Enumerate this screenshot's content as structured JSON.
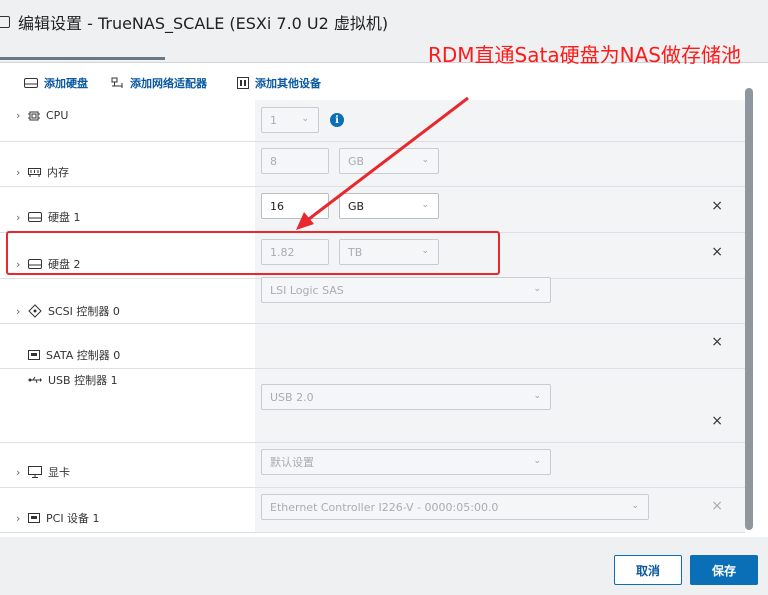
{
  "window": {
    "title": "编辑设置 - TrueNAS_SCALE (ESXi 7.0 U2 虚拟机)"
  },
  "toolbar": {
    "add_disk": "添加硬盘",
    "add_nic": "添加网络适配器",
    "add_other": "添加其他设备"
  },
  "rows": {
    "cpu": {
      "label": "CPU",
      "value": "1"
    },
    "memory": {
      "label": "内存",
      "value": "8",
      "unit": "GB"
    },
    "disk1": {
      "label": "硬盘 1",
      "value": "16",
      "unit": "GB"
    },
    "disk2": {
      "label": "硬盘 2",
      "value": "1.82",
      "unit": "TB"
    },
    "scsi": {
      "label": "SCSI 控制器 0",
      "value": "LSI Logic SAS"
    },
    "sata": {
      "label": "SATA 控制器 0"
    },
    "usb": {
      "label": "USB 控制器 1",
      "value": "USB 2.0"
    },
    "video": {
      "label": "显卡",
      "value": "默认设置"
    },
    "pci": {
      "label": "PCI 设备 1",
      "value": "Ethernet Controller I226-V - 0000:05:00.0"
    }
  },
  "icons": {
    "info": "i",
    "close": "×",
    "chevron_right": "›",
    "dropdown": "⌄"
  },
  "annotation": {
    "text": "RDM直通Sata硬盘为NAS做存储池",
    "color": "#ff1a1a"
  },
  "footer": {
    "cancel": "取消",
    "save": "保存"
  },
  "colors": {
    "accent": "#0b6fb7",
    "annotation": "#e8282c"
  }
}
